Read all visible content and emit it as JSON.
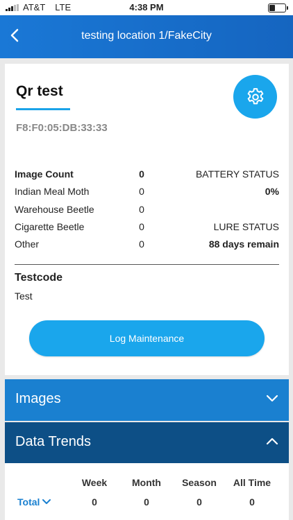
{
  "status_bar": {
    "carrier": "AT&T",
    "network": "LTE",
    "time": "4:38 PM"
  },
  "nav": {
    "title": "testing location 1/FakeCity"
  },
  "device": {
    "name": "Qr test",
    "mac": "F8:F0:05:DB:33:33"
  },
  "counts": [
    {
      "label": "Image Count",
      "value": "0"
    },
    {
      "label": "Indian Meal Moth",
      "value": "0"
    },
    {
      "label": "Warehouse Beetle",
      "value": "0"
    },
    {
      "label": "Cigarette Beetle",
      "value": "0"
    },
    {
      "label": "Other",
      "value": "0"
    }
  ],
  "battery": {
    "label": "BATTERY STATUS",
    "value": "0%"
  },
  "lure": {
    "label": "LURE STATUS",
    "value": "88 days remain"
  },
  "testcode": {
    "label": "Testcode",
    "value": "Test"
  },
  "log_button": "Log Maintenance",
  "sections": {
    "images": "Images",
    "data_trends": "Data Trends"
  },
  "trends": {
    "headers": [
      "Week",
      "Month",
      "Season",
      "All Time"
    ],
    "row_label": "Total",
    "values": [
      "0",
      "0",
      "0",
      "0"
    ]
  },
  "colors": {
    "accent": "#1aa6ec",
    "nav": "#1a78d6",
    "images_bar": "#1a80d0",
    "trends_bar": "#0d4f86"
  }
}
